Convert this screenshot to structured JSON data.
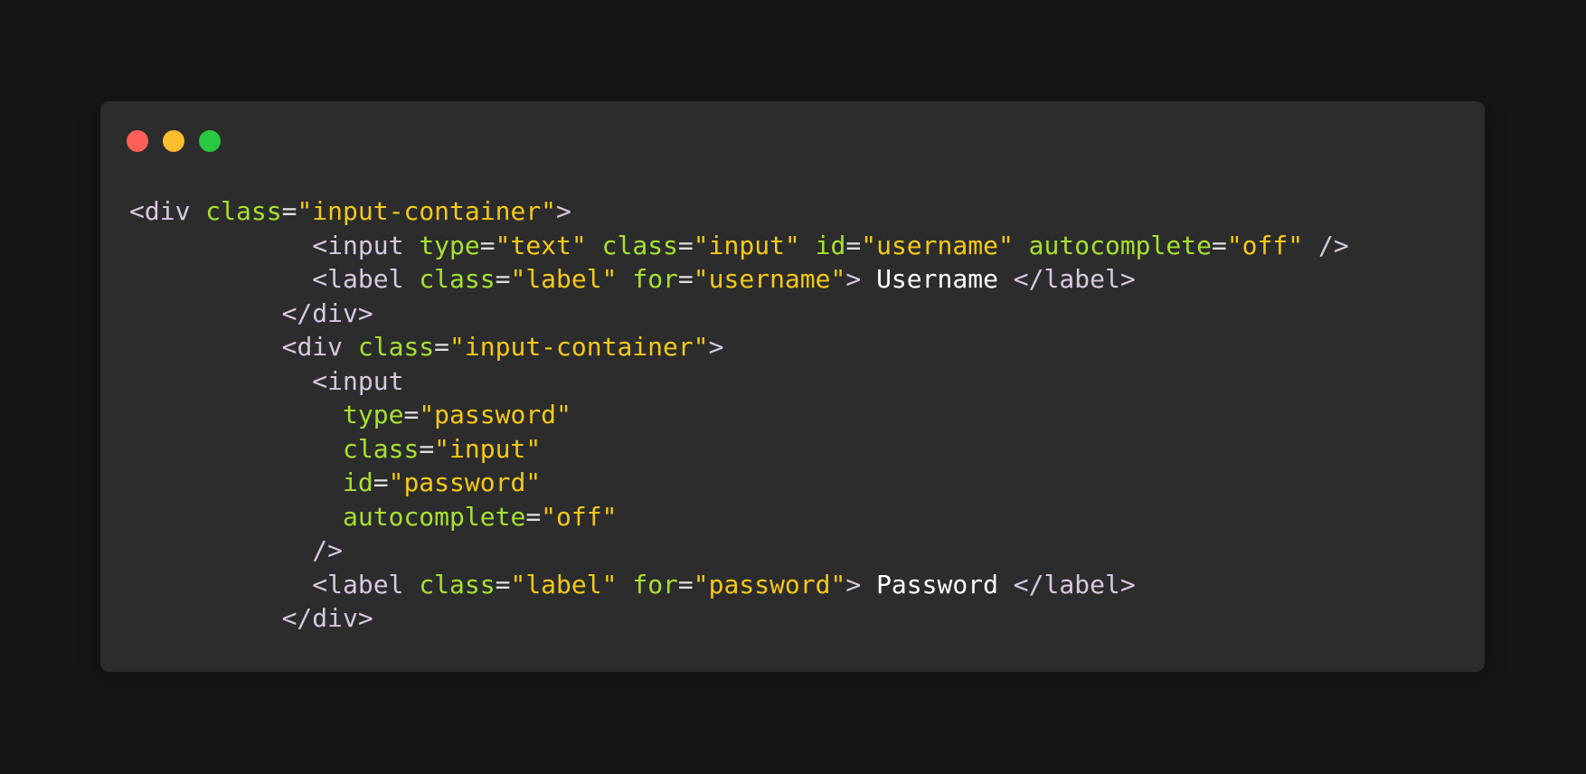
{
  "window": {
    "controls": [
      {
        "name": "close",
        "color": "#ff5f57"
      },
      {
        "name": "minimize",
        "color": "#febc2e"
      },
      {
        "name": "maximize",
        "color": "#28c840"
      }
    ]
  },
  "colors": {
    "background": "#161616",
    "window": "#2c2c2c",
    "tag": "#d7c9e2",
    "attribute": "#a6e22e",
    "string": "#f6c915",
    "text": "#ffffff"
  },
  "code_lines": [
    [
      {
        "t": "punct",
        "v": "<"
      },
      {
        "t": "tag",
        "v": "div"
      },
      {
        "t": "ws",
        "v": " "
      },
      {
        "t": "attr",
        "v": "class"
      },
      {
        "t": "eq",
        "v": "="
      },
      {
        "t": "str",
        "v": "\"input-container\""
      },
      {
        "t": "punct",
        "v": ">"
      }
    ],
    [
      {
        "t": "ws",
        "v": "            "
      },
      {
        "t": "punct",
        "v": "<"
      },
      {
        "t": "tag",
        "v": "input"
      },
      {
        "t": "ws",
        "v": " "
      },
      {
        "t": "attr",
        "v": "type"
      },
      {
        "t": "eq",
        "v": "="
      },
      {
        "t": "str",
        "v": "\"text\""
      },
      {
        "t": "ws",
        "v": " "
      },
      {
        "t": "attr",
        "v": "class"
      },
      {
        "t": "eq",
        "v": "="
      },
      {
        "t": "str",
        "v": "\"input\""
      },
      {
        "t": "ws",
        "v": " "
      },
      {
        "t": "attr",
        "v": "id"
      },
      {
        "t": "eq",
        "v": "="
      },
      {
        "t": "str",
        "v": "\"username\""
      },
      {
        "t": "ws",
        "v": " "
      },
      {
        "t": "attr",
        "v": "autocomplete"
      },
      {
        "t": "eq",
        "v": "="
      },
      {
        "t": "str",
        "v": "\"off\""
      },
      {
        "t": "ws",
        "v": " "
      },
      {
        "t": "punct",
        "v": "/>"
      }
    ],
    [
      {
        "t": "ws",
        "v": "            "
      },
      {
        "t": "punct",
        "v": "<"
      },
      {
        "t": "tag",
        "v": "label"
      },
      {
        "t": "ws",
        "v": " "
      },
      {
        "t": "attr",
        "v": "class"
      },
      {
        "t": "eq",
        "v": "="
      },
      {
        "t": "str",
        "v": "\"label\""
      },
      {
        "t": "ws",
        "v": " "
      },
      {
        "t": "attr",
        "v": "for"
      },
      {
        "t": "eq",
        "v": "="
      },
      {
        "t": "str",
        "v": "\"username\""
      },
      {
        "t": "punct",
        "v": ">"
      },
      {
        "t": "text",
        "v": " Username "
      },
      {
        "t": "punct",
        "v": "</"
      },
      {
        "t": "tag",
        "v": "label"
      },
      {
        "t": "punct",
        "v": ">"
      }
    ],
    [
      {
        "t": "ws",
        "v": "          "
      },
      {
        "t": "punct",
        "v": "</"
      },
      {
        "t": "tag",
        "v": "div"
      },
      {
        "t": "punct",
        "v": ">"
      }
    ],
    [
      {
        "t": "ws",
        "v": "          "
      },
      {
        "t": "punct",
        "v": "<"
      },
      {
        "t": "tag",
        "v": "div"
      },
      {
        "t": "ws",
        "v": " "
      },
      {
        "t": "attr",
        "v": "class"
      },
      {
        "t": "eq",
        "v": "="
      },
      {
        "t": "str",
        "v": "\"input-container\""
      },
      {
        "t": "punct",
        "v": ">"
      }
    ],
    [
      {
        "t": "ws",
        "v": "            "
      },
      {
        "t": "punct",
        "v": "<"
      },
      {
        "t": "tag",
        "v": "input"
      }
    ],
    [
      {
        "t": "ws",
        "v": "              "
      },
      {
        "t": "attr",
        "v": "type"
      },
      {
        "t": "eq",
        "v": "="
      },
      {
        "t": "str",
        "v": "\"password\""
      }
    ],
    [
      {
        "t": "ws",
        "v": "              "
      },
      {
        "t": "attr",
        "v": "class"
      },
      {
        "t": "eq",
        "v": "="
      },
      {
        "t": "str",
        "v": "\"input\""
      }
    ],
    [
      {
        "t": "ws",
        "v": "              "
      },
      {
        "t": "attr",
        "v": "id"
      },
      {
        "t": "eq",
        "v": "="
      },
      {
        "t": "str",
        "v": "\"password\""
      }
    ],
    [
      {
        "t": "ws",
        "v": "              "
      },
      {
        "t": "attr",
        "v": "autocomplete"
      },
      {
        "t": "eq",
        "v": "="
      },
      {
        "t": "str",
        "v": "\"off\""
      }
    ],
    [
      {
        "t": "ws",
        "v": "            "
      },
      {
        "t": "punct",
        "v": "/>"
      }
    ],
    [
      {
        "t": "ws",
        "v": "            "
      },
      {
        "t": "punct",
        "v": "<"
      },
      {
        "t": "tag",
        "v": "label"
      },
      {
        "t": "ws",
        "v": " "
      },
      {
        "t": "attr",
        "v": "class"
      },
      {
        "t": "eq",
        "v": "="
      },
      {
        "t": "str",
        "v": "\"label\""
      },
      {
        "t": "ws",
        "v": " "
      },
      {
        "t": "attr",
        "v": "for"
      },
      {
        "t": "eq",
        "v": "="
      },
      {
        "t": "str",
        "v": "\"password\""
      },
      {
        "t": "punct",
        "v": ">"
      },
      {
        "t": "text",
        "v": " Password "
      },
      {
        "t": "punct",
        "v": "</"
      },
      {
        "t": "tag",
        "v": "label"
      },
      {
        "t": "punct",
        "v": ">"
      }
    ],
    [
      {
        "t": "ws",
        "v": "          "
      },
      {
        "t": "punct",
        "v": "</"
      },
      {
        "t": "tag",
        "v": "div"
      },
      {
        "t": "punct",
        "v": ">"
      }
    ]
  ]
}
